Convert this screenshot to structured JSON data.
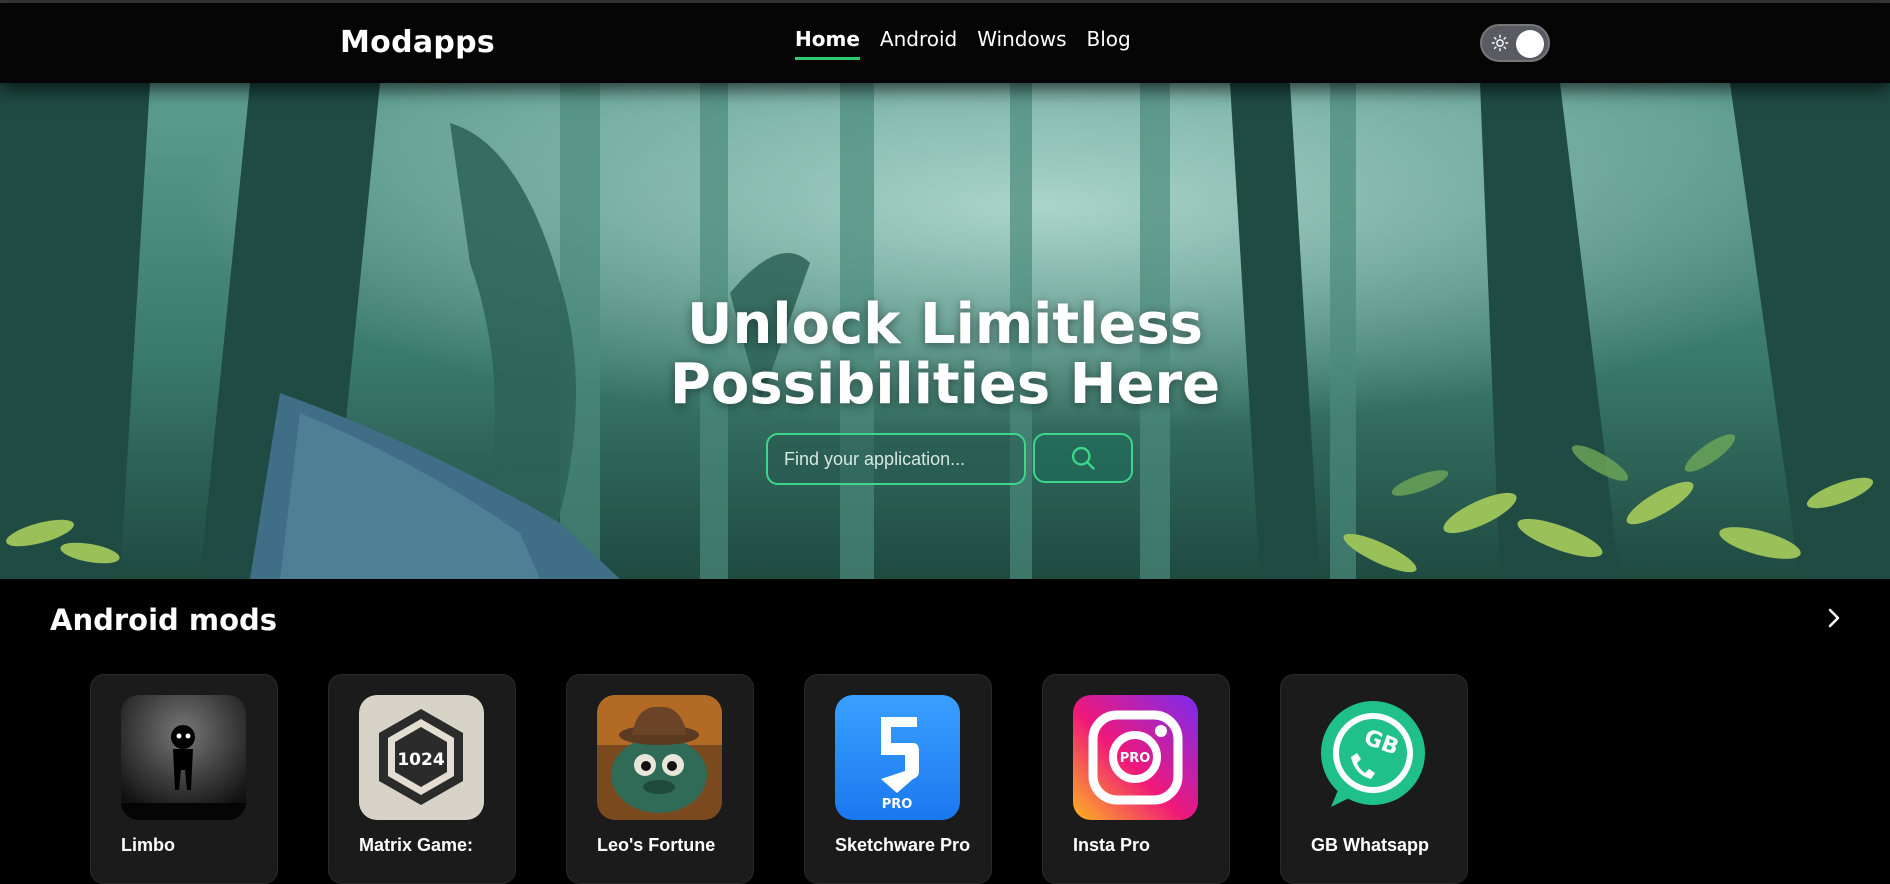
{
  "header": {
    "brand": "Modapps",
    "nav": [
      {
        "label": "Home",
        "active": true
      },
      {
        "label": "Android",
        "active": false
      },
      {
        "label": "Windows",
        "active": false
      },
      {
        "label": "Blog",
        "active": false
      }
    ],
    "theme_toggle": {
      "icon": "sun-icon",
      "state": "on"
    }
  },
  "hero": {
    "title_line1": "Unlock Limitless",
    "title_line2": "Possibilities Here",
    "search": {
      "placeholder": "Find your application...",
      "value": ""
    },
    "search_button_icon": "search-icon"
  },
  "section": {
    "title": "Android mods",
    "more_icon": "chevron-right-icon"
  },
  "apps": [
    {
      "name": "Limbo"
    },
    {
      "name": "Matrix Game:",
      "icon_text": "1024"
    },
    {
      "name": "Leo's Fortune"
    },
    {
      "name": "Sketchware Pro",
      "icon_text": "PRO"
    },
    {
      "name": "Insta Pro",
      "icon_text": "PRO"
    },
    {
      "name": "GB Whatsapp",
      "icon_text": "GB"
    }
  ],
  "colors": {
    "accent": "#2ecc71",
    "background": "#000000",
    "card": "#1b1b1b"
  }
}
